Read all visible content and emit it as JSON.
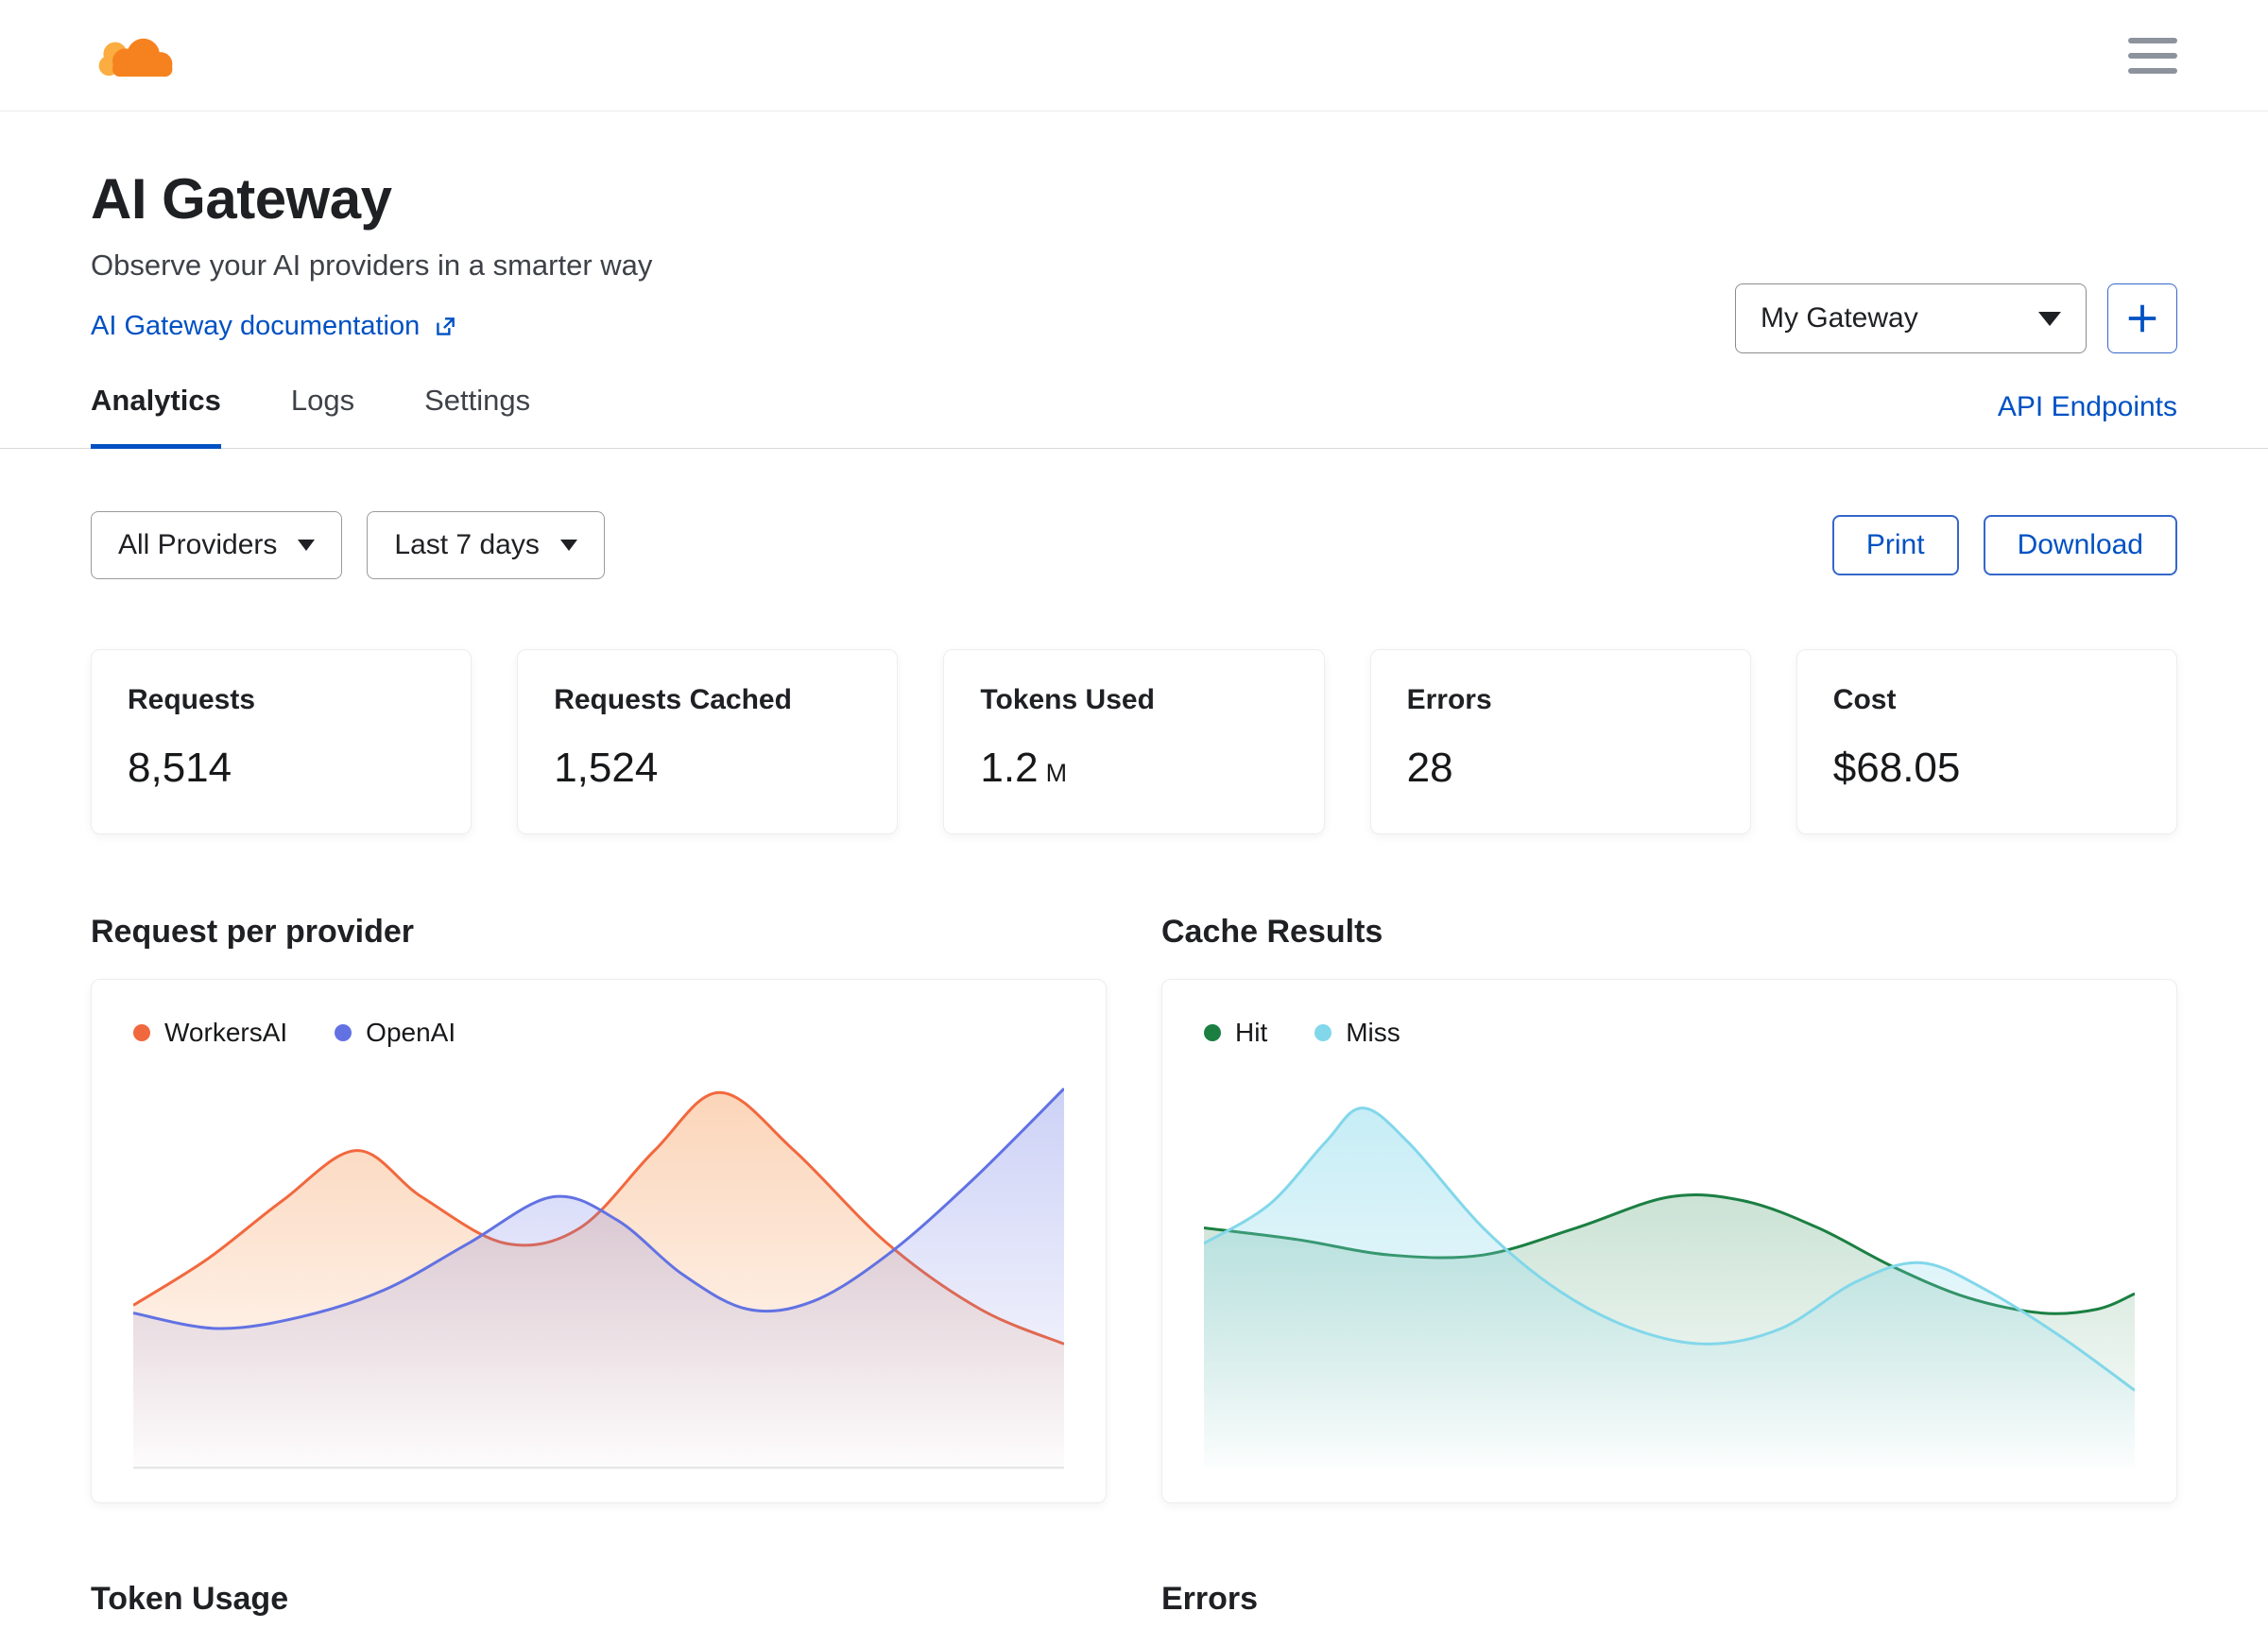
{
  "colors": {
    "accent_blue": "#0051c3",
    "brand_orange": "#f6821f",
    "brand_orange_light": "#fbad41",
    "workersai": "#f2683e",
    "openai": "#6272e3",
    "hit": "#1b7f42",
    "miss": "#82d7ea"
  },
  "icons": {
    "logo": "cloudflare-logo",
    "menu": "hamburger-icon",
    "doc_link": "external-link-icon",
    "select_caret": "chevron-down-icon",
    "add": "plus-icon"
  },
  "header": {
    "title": "AI Gateway",
    "subtitle": "Observe your AI providers in a smarter way",
    "doc_link": "AI Gateway documentation",
    "gateway_select": "My Gateway"
  },
  "tabs": {
    "items": [
      {
        "label": "Analytics",
        "active": true
      },
      {
        "label": "Logs",
        "active": false
      },
      {
        "label": "Settings",
        "active": false
      }
    ],
    "api_link": "API Endpoints"
  },
  "filters": {
    "provider": "All Providers",
    "range": "Last 7 days",
    "print": "Print",
    "download": "Download"
  },
  "stats": [
    {
      "label": "Requests",
      "value": "8,514",
      "suffix": ""
    },
    {
      "label": "Requests Cached",
      "value": "1,524",
      "suffix": ""
    },
    {
      "label": "Tokens Used",
      "value": "1.2",
      "suffix": "M"
    },
    {
      "label": "Errors",
      "value": "28",
      "suffix": ""
    },
    {
      "label": "Cost",
      "value": "$68.05",
      "suffix": ""
    }
  ],
  "chart_data": [
    {
      "type": "area",
      "title": "Request per provider",
      "legend_position": "top-left",
      "baseline": true,
      "axes_labeled": false,
      "series": [
        {
          "name": "WorkersAI",
          "color": "#f2683e",
          "fill": "rgba(246,150,80,0.40)",
          "points": [
            [
              0,
              42
            ],
            [
              8,
              54
            ],
            [
              16,
              69
            ],
            [
              24,
              82
            ],
            [
              31,
              70
            ],
            [
              40,
              58
            ],
            [
              48,
              62
            ],
            [
              56,
              82
            ],
            [
              63,
              97
            ],
            [
              71,
              82
            ],
            [
              81,
              58
            ],
            [
              91,
              41
            ],
            [
              100,
              32
            ]
          ]
        },
        {
          "name": "OpenAI",
          "color": "#6272e3",
          "fill": "rgba(99,113,227,0.32)",
          "points": [
            [
              0,
              40
            ],
            [
              9,
              36
            ],
            [
              18,
              39
            ],
            [
              27,
              46
            ],
            [
              36,
              58
            ],
            [
              45,
              70
            ],
            [
              52,
              64
            ],
            [
              59,
              50
            ],
            [
              66,
              41
            ],
            [
              73,
              43
            ],
            [
              81,
              55
            ],
            [
              90,
              74
            ],
            [
              100,
              98
            ]
          ]
        }
      ]
    },
    {
      "type": "area",
      "title": "Cache Results",
      "legend_position": "top-left",
      "baseline": false,
      "axes_labeled": false,
      "series": [
        {
          "name": "Hit",
          "color": "#1b7f42",
          "fill": "rgba(46,140,85,0.25)",
          "points": [
            [
              0,
              62
            ],
            [
              10,
              59
            ],
            [
              20,
              55
            ],
            [
              30,
              55
            ],
            [
              40,
              62
            ],
            [
              50,
              70
            ],
            [
              58,
              69
            ],
            [
              66,
              62
            ],
            [
              74,
              52
            ],
            [
              82,
              44
            ],
            [
              90,
              40
            ],
            [
              96,
              41
            ],
            [
              100,
              45
            ]
          ]
        },
        {
          "name": "Miss",
          "color": "#82d7ea",
          "fill": "rgba(130,215,234,0.45)",
          "points": [
            [
              0,
              58
            ],
            [
              7,
              68
            ],
            [
              13,
              84
            ],
            [
              17,
              93
            ],
            [
              22,
              84
            ],
            [
              30,
              62
            ],
            [
              38,
              46
            ],
            [
              46,
              36
            ],
            [
              54,
              32
            ],
            [
              62,
              36
            ],
            [
              70,
              48
            ],
            [
              77,
              53
            ],
            [
              84,
              46
            ],
            [
              92,
              34
            ],
            [
              100,
              20
            ]
          ]
        }
      ]
    }
  ],
  "bottom_sections": [
    "Token Usage",
    "Errors"
  ]
}
